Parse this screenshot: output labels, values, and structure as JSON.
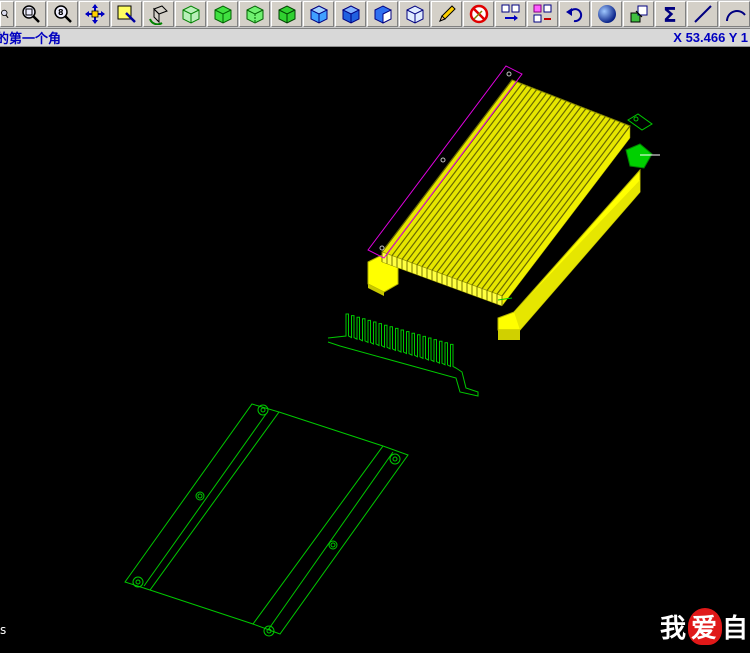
{
  "toolbar": {
    "buttons": [
      {
        "name": "zoom-partial-icon"
      },
      {
        "name": "zoom-window-icon"
      },
      {
        "name": "zoom-fit-icon"
      },
      {
        "name": "pan-icon"
      },
      {
        "name": "select-edit-icon"
      },
      {
        "name": "rotate-view-icon"
      },
      {
        "name": "cube-wire-1-icon"
      },
      {
        "name": "cube-wire-2-icon"
      },
      {
        "name": "cube-wire-3-icon"
      },
      {
        "name": "cube-wire-4-icon"
      },
      {
        "name": "cube-blue-1-icon"
      },
      {
        "name": "cube-blue-2-icon"
      },
      {
        "name": "cube-blue-3-icon"
      },
      {
        "name": "cube-blue-4-icon"
      },
      {
        "name": "pencil-icon"
      },
      {
        "name": "no-draw-icon"
      },
      {
        "name": "transform-1-icon"
      },
      {
        "name": "transform-2-icon"
      },
      {
        "name": "undo-icon"
      },
      {
        "name": "shaded-sphere-icon"
      },
      {
        "name": "layers-icon"
      },
      {
        "name": "sigma-icon"
      },
      {
        "name": "line-icon"
      },
      {
        "name": "arc-icon"
      }
    ]
  },
  "status": {
    "prompt": "的第一个角",
    "coords": "X 53.466  Y 1"
  },
  "watermark": {
    "text_before": "我",
    "text_heart": "爱",
    "text_after": "自"
  },
  "corner_char": "s",
  "colors": {
    "heatsink_fill": "#e6e600",
    "fins": "#c8c800",
    "base": "#ffff00",
    "wire_green": "#00c800",
    "selected_magenta": "#e000e0",
    "background": "#000000"
  }
}
